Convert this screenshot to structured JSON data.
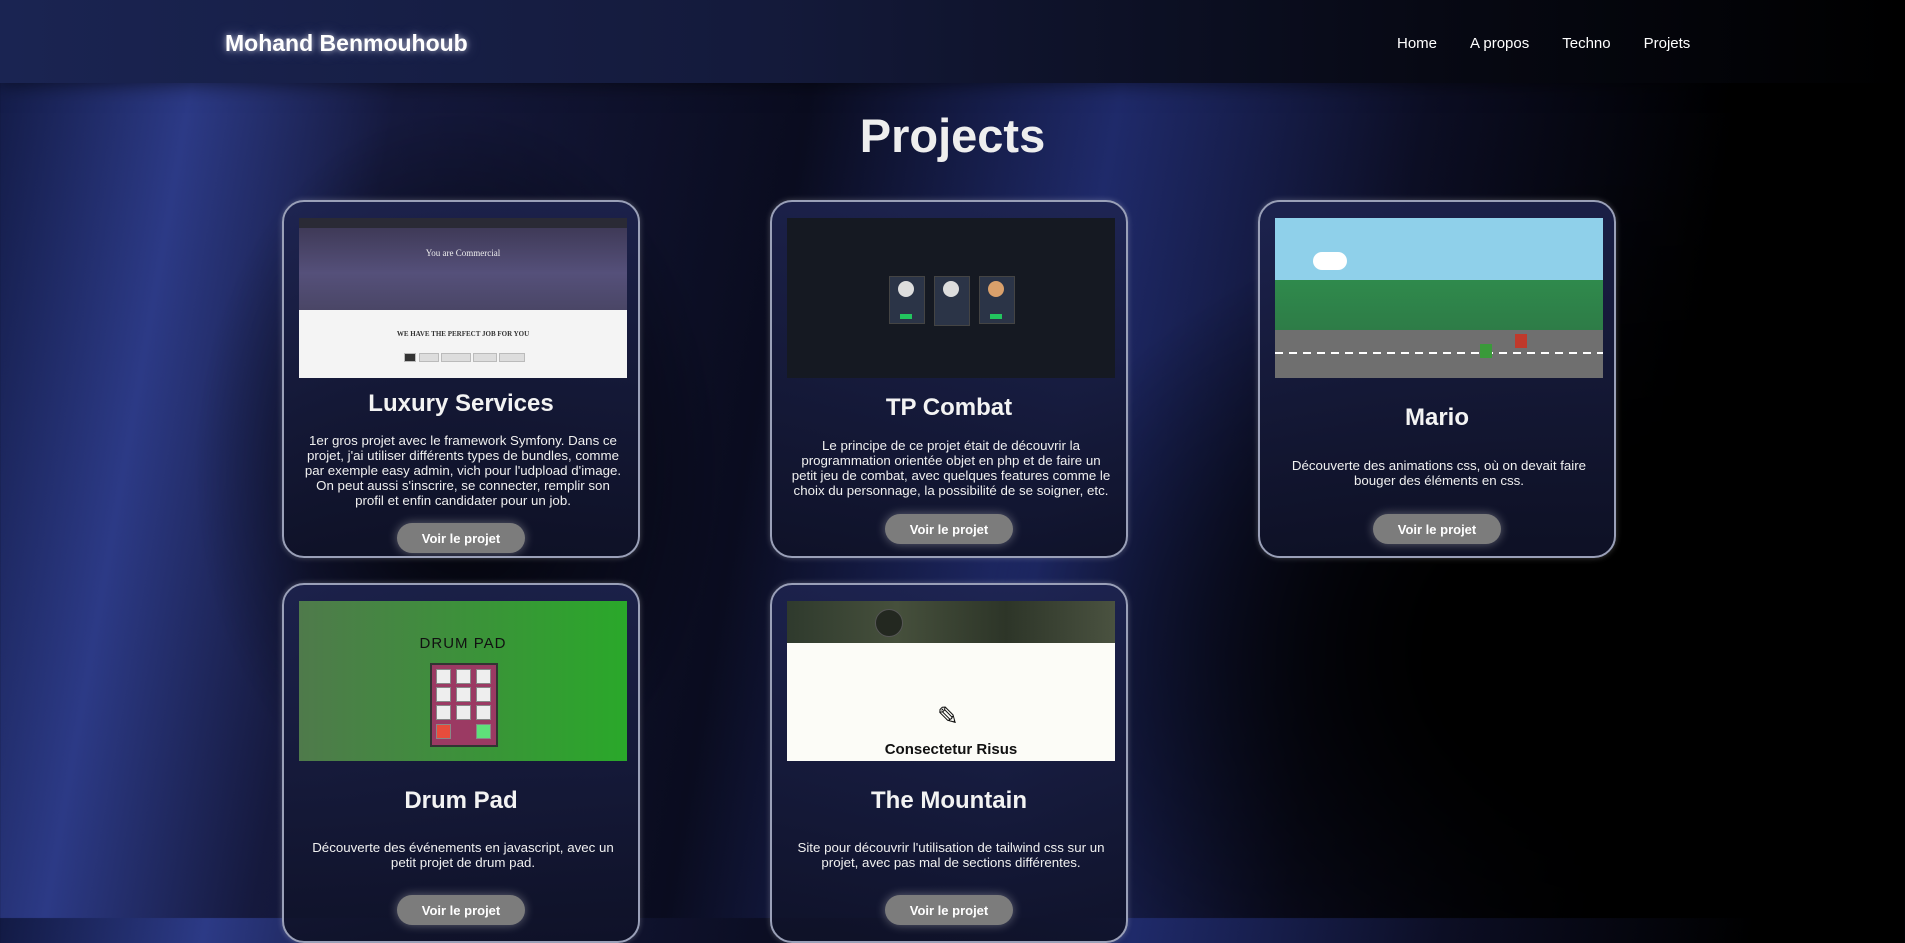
{
  "header": {
    "logo": "Mohand Benmouhoub",
    "nav": [
      "Home",
      "A propos",
      "Techno",
      "Projets"
    ]
  },
  "page_title": "Projects",
  "projects": [
    {
      "title": "Luxury Services",
      "description": "1er gros projet avec le framework Symfony. Dans ce projet, j'ai utiliser différents types de bundles, comme par exemple easy admin, vich pour l'udpload d'image. On peut aussi s'inscrire, se connecter, remplir son profil et enfin candidater pour un job.",
      "button": "Voir le projet",
      "thumb": {
        "hero_text": "You are Commercial",
        "heading": "WE HAVE THE PERFECT JOB FOR YOU"
      }
    },
    {
      "title": "TP Combat",
      "description": "Le principe de ce projet était de découvrir la programmation orientée objet en php et de faire un petit jeu de combat, avec quelques features comme le choix du personnage, la possibilité de se soigner, etc.",
      "button": "Voir le projet"
    },
    {
      "title": "Mario",
      "description": "Découverte des animations css, où on devait faire bouger des éléments en css.",
      "button": "Voir le projet"
    },
    {
      "title": "Drum Pad",
      "description": "Découverte des événements en javascript, avec un petit projet de drum pad.",
      "button": "Voir le projet",
      "thumb": {
        "heading": "DRUM PAD"
      }
    },
    {
      "title": "The Mountain",
      "description": "Site pour découvrir l'utilisation de tailwind css sur un projet, avec pas mal de sections différentes.",
      "button": "Voir le projet",
      "thumb": {
        "caption": "Consectetur Risus",
        "icon": "pencil-icon"
      }
    }
  ]
}
